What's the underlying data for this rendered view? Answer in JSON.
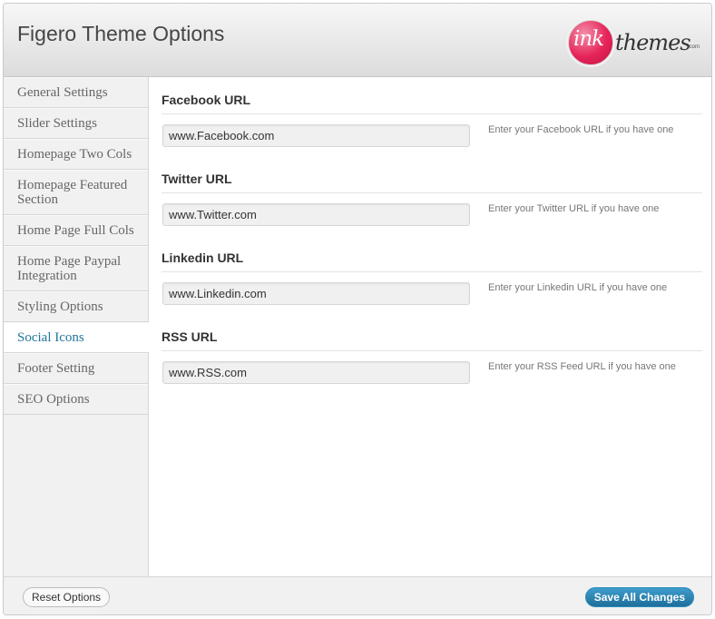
{
  "header": {
    "title": "Figero Theme Options",
    "logo": {
      "ink": "ink",
      "themes": "themes",
      "com": ".com",
      "accent": "#e5245a"
    }
  },
  "sidebar": {
    "items": [
      {
        "label": "General Settings",
        "active": false
      },
      {
        "label": "Slider Settings",
        "active": false
      },
      {
        "label": "Homepage Two Cols",
        "active": false
      },
      {
        "label": "Homepage Featured Section",
        "active": false
      },
      {
        "label": "Home Page Full Cols",
        "active": false
      },
      {
        "label": "Home Page Paypal Integration",
        "active": false
      },
      {
        "label": "Styling Options",
        "active": false
      },
      {
        "label": "Social Icons",
        "active": true
      },
      {
        "label": "Footer Setting",
        "active": false
      },
      {
        "label": "SEO Options",
        "active": false
      }
    ]
  },
  "main": {
    "sections": [
      {
        "title": "Facebook URL",
        "value": "www.Facebook.com",
        "help": "Enter your Facebook URL if you have one"
      },
      {
        "title": "Twitter URL",
        "value": "www.Twitter.com",
        "help": "Enter your Twitter URL if you have one"
      },
      {
        "title": "Linkedin URL",
        "value": "www.Linkedin.com",
        "help": "Enter your Linkedin URL if you have one"
      },
      {
        "title": "RSS URL",
        "value": "www.RSS.com",
        "help": "Enter your RSS Feed URL if you have one"
      }
    ]
  },
  "footer": {
    "reset_label": "Reset Options",
    "save_label": "Save All Changes"
  },
  "colors": {
    "active_nav": "#21759b",
    "save_button": "#2a8ac0"
  }
}
